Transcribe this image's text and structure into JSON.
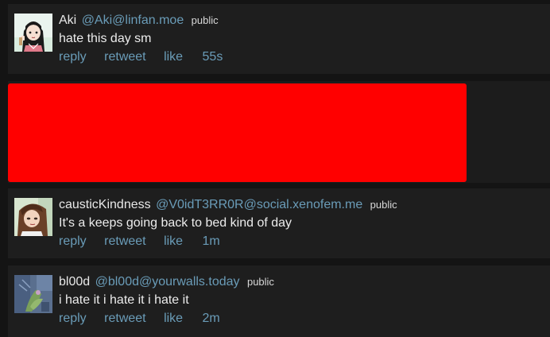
{
  "posts": [
    {
      "name": "Aki",
      "handle": "@Aki@linfan.moe",
      "visibility": "public",
      "text": "hate this day sm",
      "actions": {
        "reply": "reply",
        "retweet": "retweet",
        "like": "like"
      },
      "time": "55s",
      "avatar_icon": "anime-girl-avatar"
    },
    {
      "name": "causticKindness",
      "handle": "@V0idT3RR0R@social.xenofem.me",
      "visibility": "public",
      "text": "It's a keeps going back to bed kind of day",
      "actions": {
        "reply": "reply",
        "retweet": "retweet",
        "like": "like"
      },
      "time": "1m",
      "avatar_icon": "brown-hair-avatar"
    },
    {
      "name": "bl00d",
      "handle": "@bl00d@yourwalls.today",
      "visibility": "public",
      "text": "i hate it i hate it i hate it",
      "actions": {
        "reply": "reply",
        "retweet": "retweet",
        "like": "like"
      },
      "time": "2m",
      "avatar_icon": "blue-plant-avatar"
    }
  ],
  "colors": {
    "background": "#141414",
    "card": "#1e1e1e",
    "link": "#6a9cb8",
    "text": "#ececec",
    "redacted": "#ff0000"
  }
}
